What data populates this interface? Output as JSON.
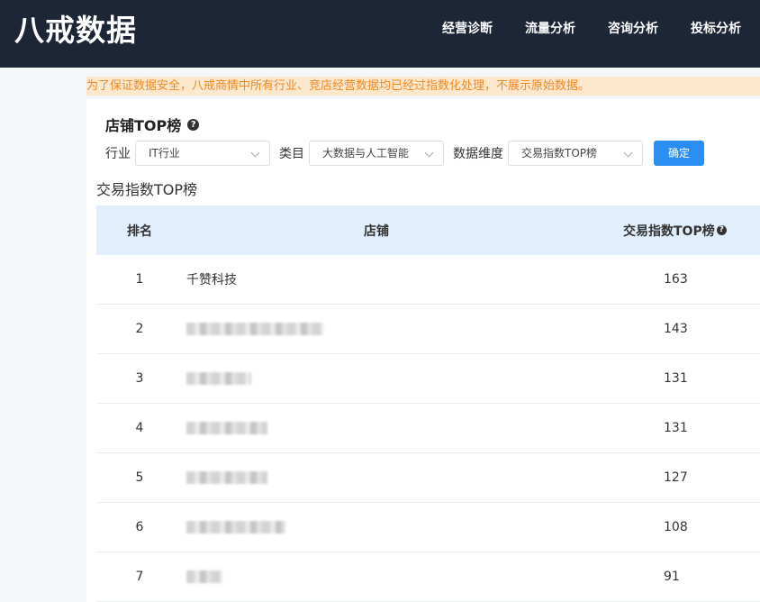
{
  "app": {
    "logo": "八戒数据",
    "nav": [
      "经营诊断",
      "流量分析",
      "咨询分析",
      "投标分析"
    ]
  },
  "notice": "为了保证数据安全，八戒商情中所有行业、竞店经营数据均已经过指数化处理，不展示原始数据。",
  "section": {
    "title": "店铺TOP榜",
    "help_icon": "question-circle-icon"
  },
  "filters": {
    "industry_label": "行业",
    "industry_value": "IT行业",
    "category_label": "类目",
    "category_value": "大数据与人工智能",
    "dimension_label": "数据维度",
    "dimension_value": "交易指数TOP榜",
    "confirm_label": "确定"
  },
  "table": {
    "title": "交易指数TOP榜",
    "headers": {
      "rank": "排名",
      "store": "店铺",
      "index": "交易指数TOP榜"
    },
    "rows": [
      {
        "rank": "1",
        "store": "千赞科技",
        "index": "163",
        "blurred": false
      },
      {
        "rank": "2",
        "store": "",
        "index": "143",
        "blurred": true
      },
      {
        "rank": "3",
        "store": "",
        "index": "131",
        "blurred": true
      },
      {
        "rank": "4",
        "store": "",
        "index": "131",
        "blurred": true
      },
      {
        "rank": "5",
        "store": "",
        "index": "127",
        "blurred": true
      },
      {
        "rank": "6",
        "store": "",
        "index": "108",
        "blurred": true
      },
      {
        "rank": "7",
        "store": "",
        "index": "91",
        "blurred": true
      }
    ]
  },
  "colors": {
    "topbar": "#1d2636",
    "notice_bg": "#fde7cd",
    "notice_text": "#f08a24",
    "accent": "#2b8ef3",
    "table_header_bg": "#e1eefc"
  }
}
